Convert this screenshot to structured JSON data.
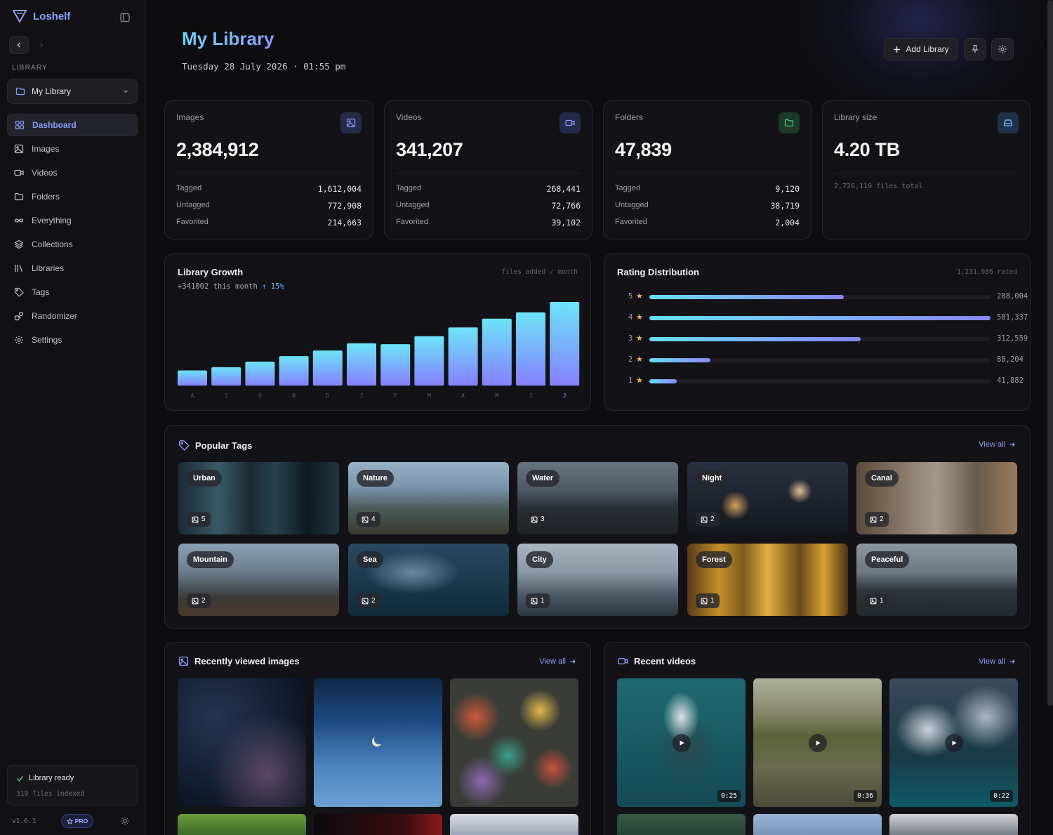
{
  "app": {
    "name": "Loshelf",
    "version": "v1.6.1",
    "pro_label": "PRO"
  },
  "sidebar": {
    "library_caption": "LIBRARY",
    "library_select": "My Library",
    "items": [
      {
        "label": "Dashboard",
        "icon": "dashboard-icon",
        "active": true
      },
      {
        "label": "Images",
        "icon": "image-icon"
      },
      {
        "label": "Videos",
        "icon": "video-icon"
      },
      {
        "label": "Folders",
        "icon": "folder-icon"
      },
      {
        "label": "Everything",
        "icon": "infinity-icon"
      },
      {
        "label": "Collections",
        "icon": "layers-icon"
      },
      {
        "label": "Libraries",
        "icon": "library-icon"
      },
      {
        "label": "Tags",
        "icon": "tag-icon"
      },
      {
        "label": "Randomizer",
        "icon": "shapes-icon"
      },
      {
        "label": "Settings",
        "icon": "gear-icon"
      }
    ],
    "status_title": "Library ready",
    "status_sub": "319 files indexed"
  },
  "header": {
    "title": "My Library",
    "date": "Tuesday 28 July 2026 · 01:55 pm",
    "add_library": "Add Library"
  },
  "stats": [
    {
      "label": "Images",
      "value": "2,384,912",
      "rows": [
        [
          "Tagged",
          "1,612,004"
        ],
        [
          "Untagged",
          "772,908"
        ],
        [
          "Favorited",
          "214,663"
        ]
      ],
      "icon": "image-icon",
      "color": "#8b9cff"
    },
    {
      "label": "Videos",
      "value": "341,207",
      "rows": [
        [
          "Tagged",
          "268,441"
        ],
        [
          "Untagged",
          "72,766"
        ],
        [
          "Favorited",
          "39,102"
        ]
      ],
      "icon": "video-icon",
      "color": "#8b9cff"
    },
    {
      "label": "Folders",
      "value": "47,839",
      "rows": [
        [
          "Tagged",
          "9,120"
        ],
        [
          "Untagged",
          "38,719"
        ],
        [
          "Favorited",
          "2,004"
        ]
      ],
      "icon": "folder-icon",
      "color": "#4fd08a"
    },
    {
      "label": "Library size",
      "value": "4.20 TB",
      "note": "2,726,119 files total",
      "icon": "drive-icon",
      "color": "#7cc0ff"
    }
  ],
  "growth": {
    "title": "Library Growth",
    "hint": "files added / month",
    "sub": "+341002 this month",
    "change": "↑ 15%"
  },
  "chart_data": {
    "type": "bar",
    "categories": [
      "A",
      "S",
      "O",
      "N",
      "D",
      "J",
      "F",
      "M",
      "A",
      "M",
      "J",
      "J"
    ],
    "values": [
      19,
      23,
      30,
      37,
      44,
      53,
      52,
      62,
      73,
      84,
      92,
      105
    ]
  },
  "ratings": {
    "title": "Rating Distribution",
    "hint": "1,231,986 rated",
    "rows": [
      {
        "stars": "5",
        "count": "288,004",
        "fraction": 0.57
      },
      {
        "stars": "4",
        "count": "501,337",
        "fraction": 1.0
      },
      {
        "stars": "3",
        "count": "312,559",
        "fraction": 0.62
      },
      {
        "stars": "2",
        "count": "88,204",
        "fraction": 0.18
      },
      {
        "stars": "1",
        "count": "41,882",
        "fraction": 0.08
      }
    ]
  },
  "popular_tags": {
    "title": "Popular Tags",
    "view_all": "View all",
    "tags": [
      {
        "name": "Urban",
        "count": "5"
      },
      {
        "name": "Nature",
        "count": "4"
      },
      {
        "name": "Water",
        "count": "3"
      },
      {
        "name": "Night",
        "count": "2"
      },
      {
        "name": "Canal",
        "count": "2"
      },
      {
        "name": "Mountain",
        "count": "2"
      },
      {
        "name": "Sea",
        "count": "2"
      },
      {
        "name": "City",
        "count": "1"
      },
      {
        "name": "Forest",
        "count": "1"
      },
      {
        "name": "Peaceful",
        "count": "1"
      }
    ]
  },
  "recent_images": {
    "title": "Recently viewed images",
    "view_all": "View all"
  },
  "recent_videos": {
    "title": "Recent videos",
    "view_all": "View all",
    "durations": [
      "0:25",
      "0:36",
      "0:22"
    ]
  }
}
